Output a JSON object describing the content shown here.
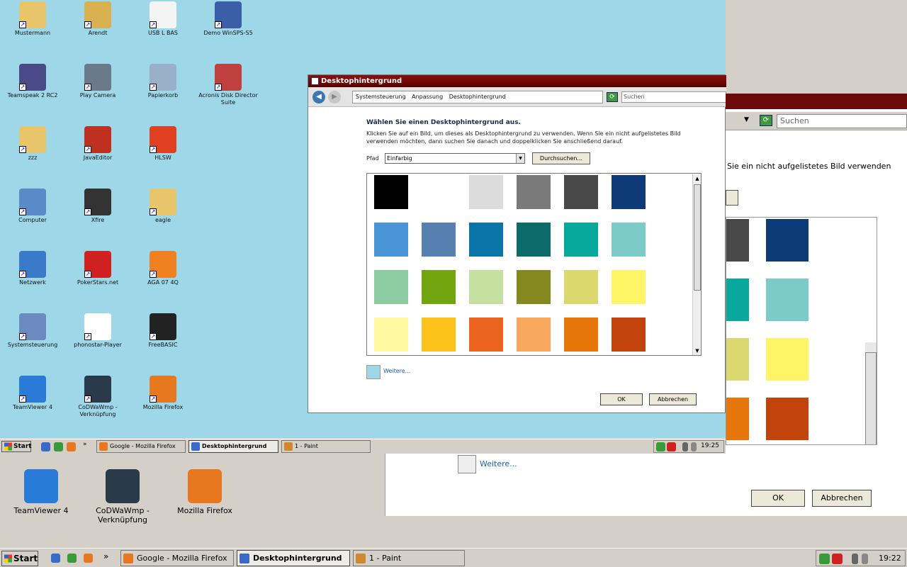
{
  "desktop_icons": [
    {
      "label": "Mustermann",
      "color": "#e8c56a"
    },
    {
      "label": "Arendt",
      "color": "#d8b050"
    },
    {
      "label": "USB L BAS",
      "color": "#f4f4f4"
    },
    {
      "label": "Demo WinSPS-S5",
      "color": "#3a5fa8"
    },
    {
      "label": "Teamspeak 2 RC2",
      "color": "#4a4a88"
    },
    {
      "label": "Play Camera",
      "color": "#6a7a8a"
    },
    {
      "label": "Papierkorb",
      "color": "#9ab0c8"
    },
    {
      "label": "Acronis Disk Director Suite",
      "color": "#c04040"
    },
    {
      "label": "zzz",
      "color": "#e8c56a"
    },
    {
      "label": "JavaEditor",
      "color": "#c03020"
    },
    {
      "label": "HLSW",
      "color": "#e04020"
    },
    {
      "label": "",
      "color": "#9ed8e8"
    },
    {
      "label": "Computer",
      "color": "#5a8ac8"
    },
    {
      "label": "Xfire",
      "color": "#333333"
    },
    {
      "label": "eagle",
      "color": "#e8c56a"
    },
    {
      "label": "",
      "color": "#9ed8e8"
    },
    {
      "label": "Netzwerk",
      "color": "#3a7ac8"
    },
    {
      "label": "PokerStars.net",
      "color": "#d02020"
    },
    {
      "label": "AGA 07 4Q",
      "color": "#f08020"
    },
    {
      "label": "",
      "color": "#9ed8e8"
    },
    {
      "label": "Systemsteuerung",
      "color": "#6a8ac0"
    },
    {
      "label": "phonostar-Player",
      "color": "#ffffff"
    },
    {
      "label": "FreeBASIC",
      "color": "#222222"
    },
    {
      "label": "",
      "color": "#9ed8e8"
    },
    {
      "label": "TeamViewer 4",
      "color": "#2a7ad8"
    },
    {
      "label": "CoDWaWmp - Verknüpfung",
      "color": "#2a3a4a"
    },
    {
      "label": "Mozilla Firefox",
      "color": "#e87820"
    }
  ],
  "lower_icons": [
    {
      "label": "TeamViewer 4",
      "color": "#2a7ad8"
    },
    {
      "label": "CoDWaWmp - Verknüpfung",
      "color": "#2a3a4a"
    },
    {
      "label": "Mozilla Firefox",
      "color": "#e87820"
    }
  ],
  "dialog": {
    "title": "Desktophintergrund",
    "breadcrumb": [
      "Systemsteuerung",
      "Anpassung",
      "Desktophintergrund"
    ],
    "search_placeholder": "Suchen",
    "heading": "Wählen Sie einen Desktophintergrund aus.",
    "description": "Klicken Sie auf ein Bild, um dieses als Desktophintergrund zu verwenden. Wenn Sie ein nicht aufgelistetes Bild verwenden möchten, dann suchen Sie danach und doppelklicken Sie anschließend darauf.",
    "path_label": "Pfad",
    "path_value": "Einfarbig",
    "browse_label": "Durchsuchen...",
    "more_label": "Weitere...",
    "ok_label": "OK",
    "cancel_label": "Abbrechen",
    "swatches": [
      "#000000",
      "#ffffff",
      "#dcdcdc",
      "#7a7a7a",
      "#484848",
      "#0f3a78",
      "#4a95d6",
      "#5580b0",
      "#0a73a8",
      "#0c6a6a",
      "#08a89c",
      "#7ccbc8",
      "#8ccca0",
      "#72a510",
      "#c5e0a0",
      "#85881e",
      "#dbd870",
      "#fff366",
      "#fff8a0",
      "#fdc21a",
      "#ea6420",
      "#f8a85c",
      "#e6760a",
      "#c2440c"
    ]
  },
  "bg_window": {
    "search_placeholder": "Suchen",
    "text": "Sie ein nicht aufgelistetes Bild verwenden",
    "more_label": "Weitere...",
    "ok_label": "OK",
    "cancel_label": "Abbrechen",
    "swatches": [
      "#484848",
      "#0f3a78",
      "#08a89c",
      "#7ccbc8",
      "#dbd870",
      "#fff366",
      "#e6760a",
      "#c2440c"
    ]
  },
  "taskbar_small": {
    "start_label": "Start",
    "tasks": [
      {
        "label": "Google - Mozilla Firefox",
        "active": false
      },
      {
        "label": "Desktophintergrund",
        "active": true
      },
      {
        "label": "1 - Paint",
        "active": false
      }
    ],
    "clock": "19:25"
  },
  "taskbar_large": {
    "start_label": "Start",
    "tasks": [
      {
        "label": "Google - Mozilla Firefox",
        "active": false
      },
      {
        "label": "Desktophintergrund",
        "active": true
      },
      {
        "label": "1 - Paint",
        "active": false
      }
    ],
    "clock": "19:22"
  }
}
